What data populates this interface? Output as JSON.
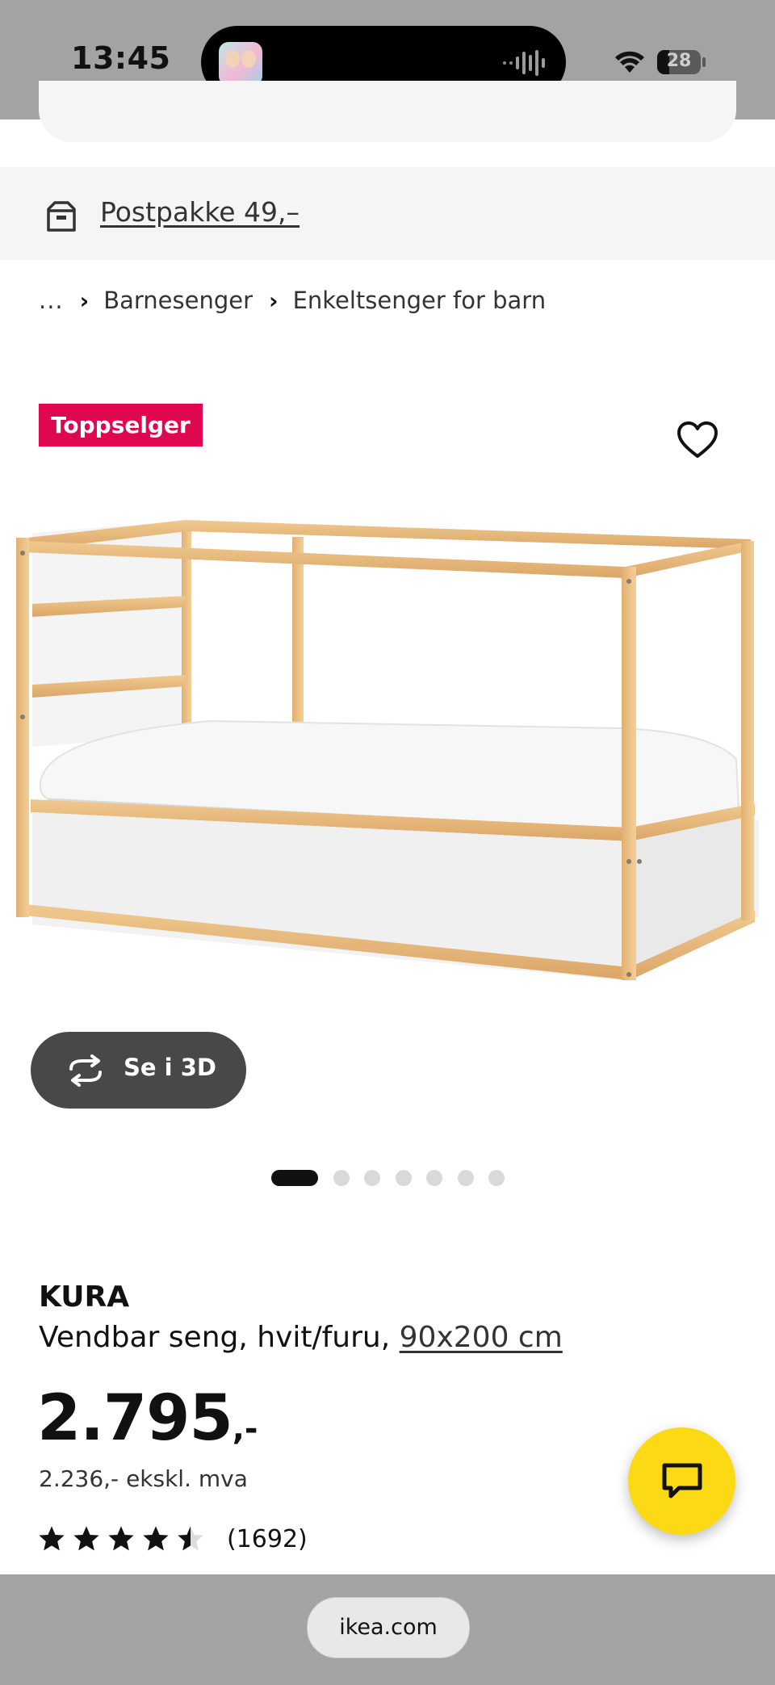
{
  "status_bar": {
    "time": "13:45",
    "battery": "28",
    "battery_level": 0.28
  },
  "delivery": {
    "label": "Postpakke 49,–",
    "icon": "package-icon"
  },
  "breadcrumb": {
    "ellipsis": "...",
    "items": [
      "Barnesenger",
      "Enkeltsenger for barn"
    ]
  },
  "badge": {
    "label": "Toppselger",
    "color": "#e00751"
  },
  "actions": {
    "favorite_icon": "heart-icon",
    "view_3d_label": "Se i 3D",
    "view_3d_icon": "rotate-3d-icon",
    "chat_icon": "chat-icon"
  },
  "carousel": {
    "total": 7,
    "active_index": 0
  },
  "product": {
    "name": "KURA",
    "description": "Vendbar seng, hvit/furu,",
    "size": "90x200 cm",
    "price": "2.795",
    "price_suffix": ",-",
    "price_ex_vat": "2.236,- ekskl. mva",
    "rating": 4.5,
    "max_rating": 5,
    "review_count": "(1692)"
  },
  "browser": {
    "url": "ikea.com"
  },
  "colors": {
    "accent_yellow": "#fbd914",
    "badge_red": "#e00751",
    "status_bar_gray": "#a3a3a3"
  }
}
